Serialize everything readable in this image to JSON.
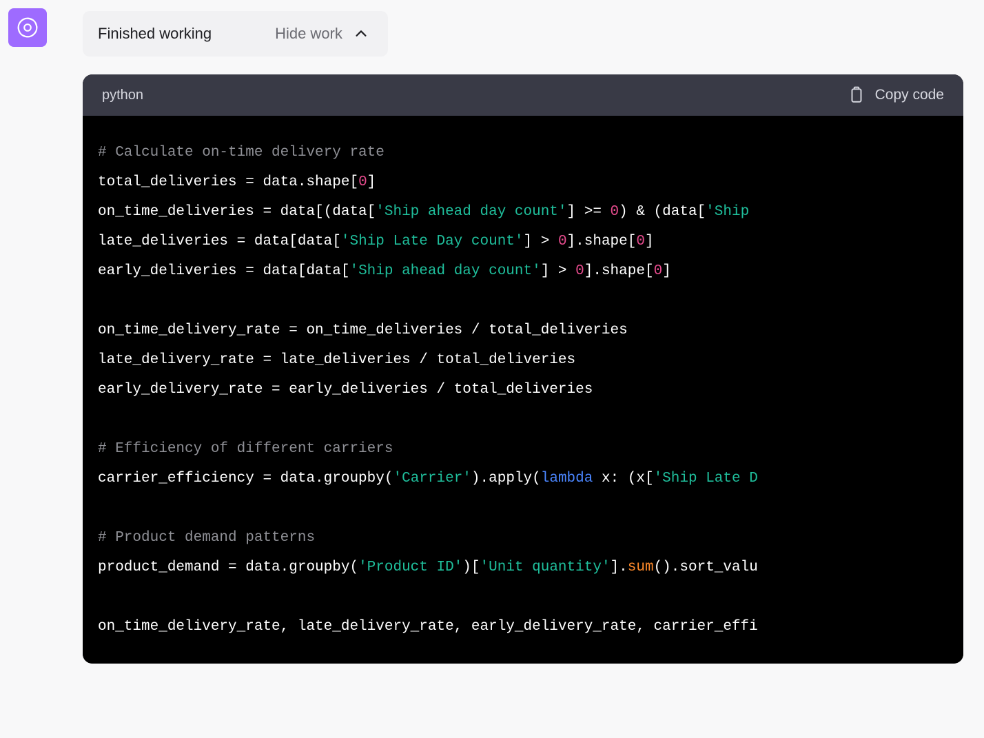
{
  "avatar": {
    "name": "assistant-avatar"
  },
  "work_toggle": {
    "status": "Finished working",
    "hide_label": "Hide work"
  },
  "code_header": {
    "language": "python",
    "copy_label": "Copy code"
  },
  "code": {
    "line1_comment": "# Calculate on-time delivery rate",
    "line2_a": "total_deliveries = data.shape[",
    "line2_num": "0",
    "line2_b": "]",
    "line3_a": "on_time_deliveries = data[(data[",
    "line3_str1": "'Ship ahead day count'",
    "line3_b": "] >= ",
    "line3_num1": "0",
    "line3_c": ") & (data[",
    "line3_str2": "'Ship ",
    "line4_a": "late_deliveries = data[data[",
    "line4_str": "'Ship Late Day count'",
    "line4_b": "] > ",
    "line4_num1": "0",
    "line4_c": "].shape[",
    "line4_num2": "0",
    "line4_d": "]",
    "line5_a": "early_deliveries = data[data[",
    "line5_str": "'Ship ahead day count'",
    "line5_b": "] > ",
    "line5_num1": "0",
    "line5_c": "].shape[",
    "line5_num2": "0",
    "line5_d": "]",
    "line7": "on_time_delivery_rate = on_time_deliveries / total_deliveries",
    "line8": "late_delivery_rate = late_deliveries / total_deliveries",
    "line9": "early_delivery_rate = early_deliveries / total_deliveries",
    "line11_comment": "# Efficiency of different carriers",
    "line12_a": "carrier_efficiency = data.groupby(",
    "line12_str1": "'Carrier'",
    "line12_b": ").apply(",
    "line12_kw": "lambda",
    "line12_c": " x: (x[",
    "line12_str2": "'Ship Late D",
    "line14_comment": "# Product demand patterns",
    "line15_a": "product_demand = data.groupby(",
    "line15_str1": "'Product ID'",
    "line15_b": ")[",
    "line15_str2": "'Unit quantity'",
    "line15_c": "].",
    "line15_call": "sum",
    "line15_d": "().sort_valu",
    "line17": "on_time_delivery_rate, late_delivery_rate, early_delivery_rate, carrier_effi"
  }
}
